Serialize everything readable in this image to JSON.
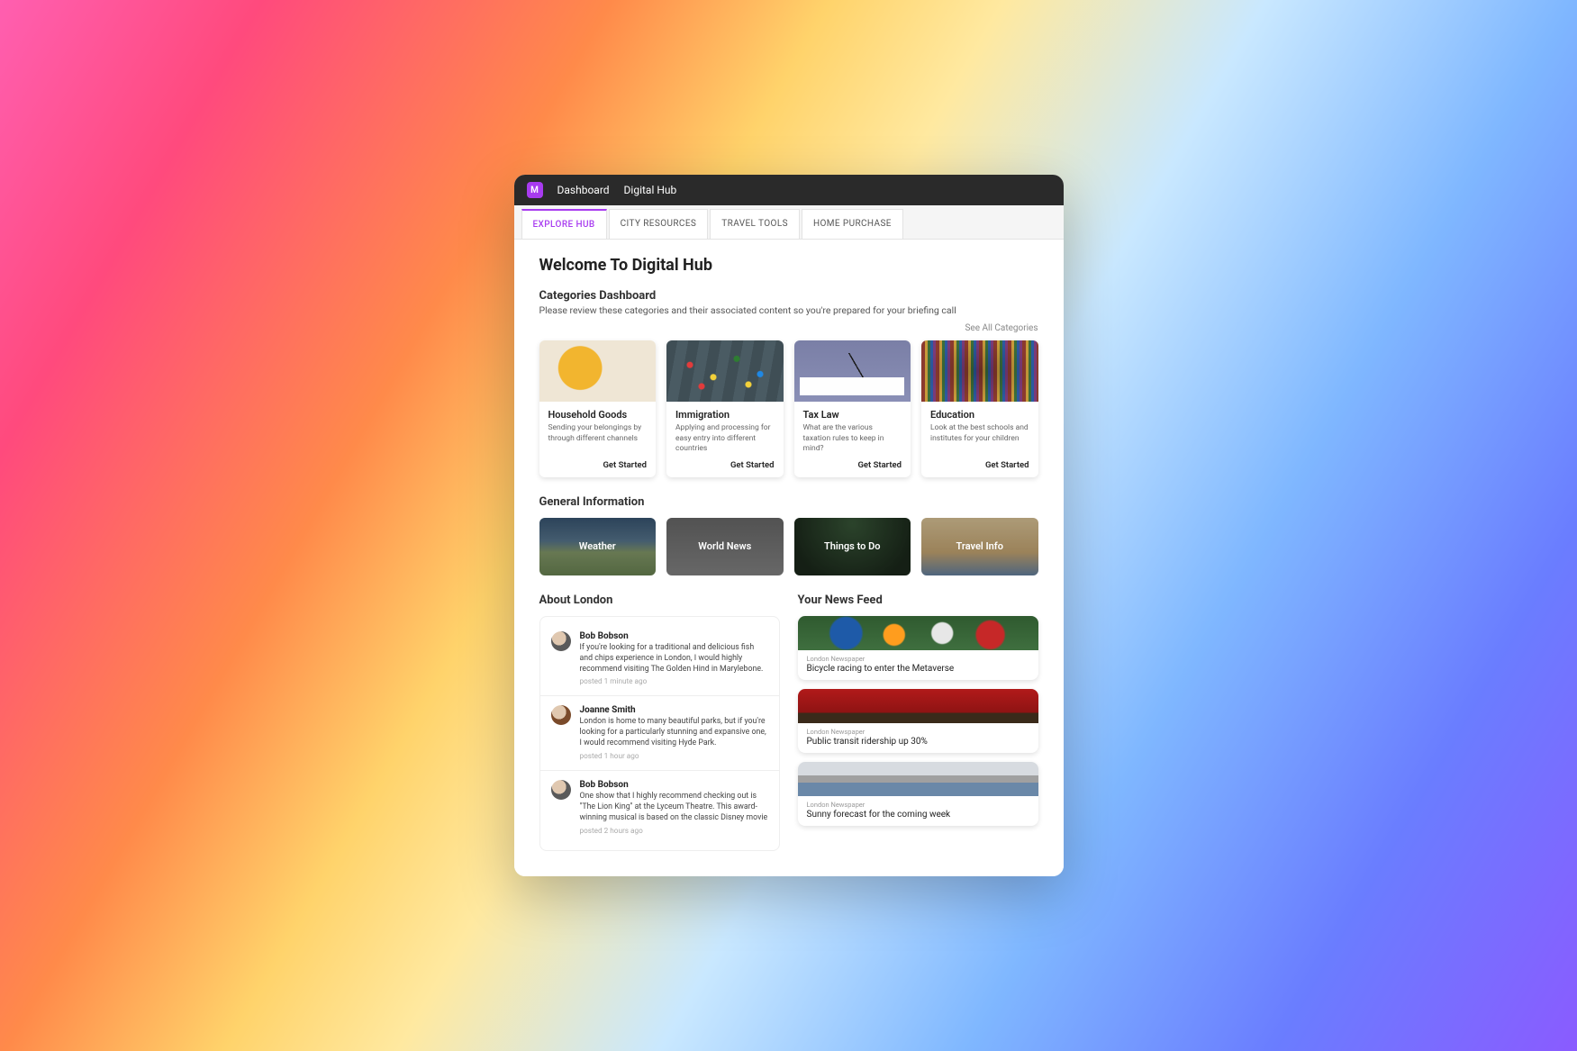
{
  "header": {
    "badge": "M",
    "nav": [
      "Dashboard",
      "Digital Hub"
    ]
  },
  "tabs": [
    {
      "label": "EXPLORE HUB",
      "active": true
    },
    {
      "label": "CITY RESOURCES",
      "active": false
    },
    {
      "label": "TRAVEL TOOLS",
      "active": false
    },
    {
      "label": "HOME PURCHASE",
      "active": false
    }
  ],
  "page": {
    "title": "Welcome To Digital Hub",
    "categories_heading": "Categories Dashboard",
    "categories_sub": "Please review these categories and their associated content so you're prepared for your briefing call",
    "see_all": "See All Categories",
    "cta": "Get Started",
    "general_heading": "General Information",
    "about_heading": "About London",
    "feed_heading": "Your News Feed"
  },
  "categories": [
    {
      "title": "Household Goods",
      "desc": "Sending your belongings by through different channels"
    },
    {
      "title": "Immigration",
      "desc": "Applying and processing for easy entry into different countries"
    },
    {
      "title": "Tax Law",
      "desc": "What are the various taxation rules to keep in mind?"
    },
    {
      "title": "Education",
      "desc": "Look at the best schools and institutes for your children"
    }
  ],
  "general": [
    {
      "label": "Weather"
    },
    {
      "label": "World News"
    },
    {
      "label": "Things to Do"
    },
    {
      "label": "Travel Info"
    }
  ],
  "posts": [
    {
      "author": "Bob Bobson",
      "text": "If you're looking for a traditional and delicious fish and chips experience in London, I would highly recommend visiting The Golden Hind in Marylebone.",
      "time": "posted 1 minute ago"
    },
    {
      "author": "Joanne Smith",
      "text": "London is home to many beautiful parks, but if you're looking for a particularly stunning and expansive one, I would recommend visiting Hyde Park.",
      "time": "posted 1 hour ago"
    },
    {
      "author": "Bob Bobson",
      "text": "One show that I highly recommend checking out is \"The Lion King\" at the Lyceum Theatre. This award-winning musical is based on the classic Disney movie",
      "time": "posted 2 hours ago"
    }
  ],
  "news": [
    {
      "source": "London Newspaper",
      "headline": "Bicycle racing to enter the Metaverse"
    },
    {
      "source": "London Newspaper",
      "headline": "Public transit ridership up 30%"
    },
    {
      "source": "London Newspaper",
      "headline": "Sunny forecast for the coming week"
    }
  ]
}
